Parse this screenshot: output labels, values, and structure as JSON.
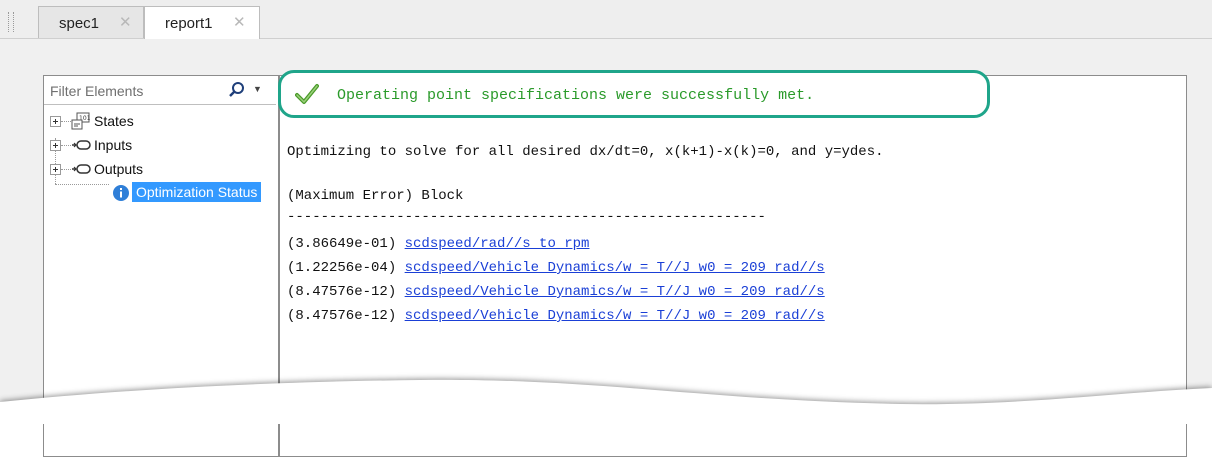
{
  "tabs": [
    {
      "label": "spec1",
      "close": "✕"
    },
    {
      "label": "report1",
      "close": "✕"
    }
  ],
  "filter": {
    "placeholder": "Filter Elements"
  },
  "tree": [
    {
      "label": "States",
      "icon": "states-icon"
    },
    {
      "label": "Inputs",
      "icon": "input-port-icon"
    },
    {
      "label": "Outputs",
      "icon": "output-port-icon"
    },
    {
      "label": "Optimization Status",
      "icon": "info-icon"
    }
  ],
  "report": {
    "status": "Operating point specifications were successfully met.",
    "objective": "Optimizing to solve for all desired dx/dt=0, x(k+1)-x(k)=0, and y=ydes.",
    "table_header": "(Maximum Error) Block",
    "separator": "---------------------------------------------------------",
    "rows": [
      {
        "error": "(3.86649e-01)",
        "block": "scdspeed/rad//s to rpm"
      },
      {
        "error": "(1.22256e-04)",
        "block": "scdspeed/Vehicle Dynamics/w = T//J w0 = 209 rad//s"
      },
      {
        "error": "(8.47576e-12)",
        "block": "scdspeed/Vehicle Dynamics/w = T//J w0 = 209 rad//s"
      },
      {
        "error": "(8.47576e-12)",
        "block": "scdspeed/Vehicle Dynamics/w = T//J w0 = 209 rad//s"
      }
    ]
  },
  "colors": {
    "status_green": "#2a9a2a",
    "highlight_border": "#1fa58a",
    "link": "#1a3fd6",
    "selection": "#3399ff"
  }
}
